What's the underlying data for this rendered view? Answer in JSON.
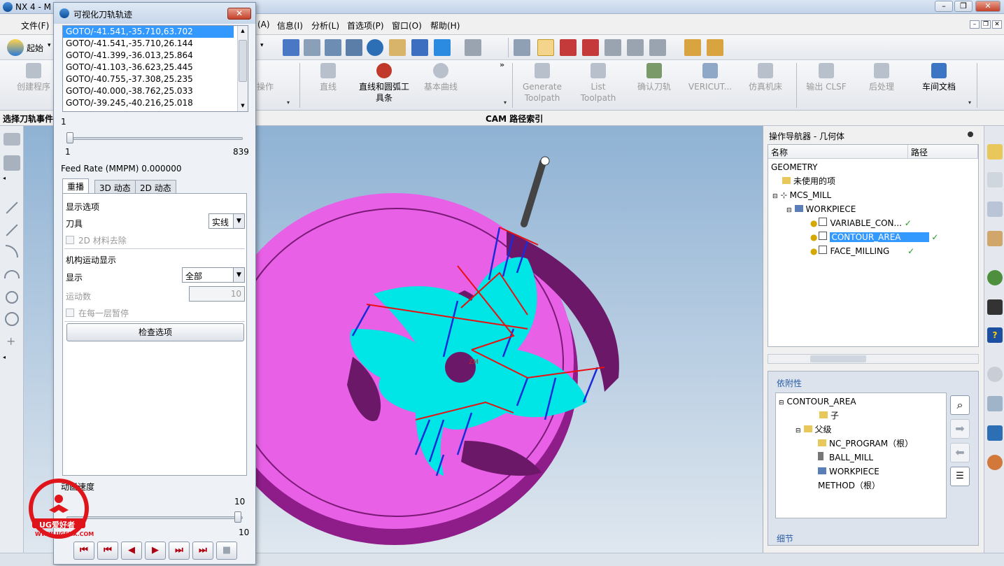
{
  "window": {
    "title": "NX 4 - M"
  },
  "menu": {
    "file": "文件(F)",
    "start": "起始",
    "a": "(A)",
    "info": "信息(I)",
    "analysis": "分析(L)",
    "prefs": "首选项(P)",
    "window": "窗口(O)",
    "help": "帮助(H)"
  },
  "toolbar2": {
    "create_program": "创建程序",
    "operation": "操作",
    "line": "直线",
    "line_arc_1": "直线和圆弧工",
    "line_arc_2": "具条",
    "basic_curve": "基本曲线",
    "generate_1": "Generate",
    "generate_2": "Toolpath",
    "list_1": "List",
    "list_2": "Toolpath",
    "verify": "确认刀轨",
    "vericut": "VERICUT...",
    "simulate": "仿真机床",
    "output_clsf": "输出 CLSF",
    "postprocess": "后处理",
    "shop_doc": "车间文档",
    "chevron": "»"
  },
  "cueline": {
    "left": "选择刀轨事件",
    "center": "CAM 路径索引"
  },
  "dialog": {
    "title": "可视化刀轨轨迹",
    "close": "✕",
    "goto_lines": [
      "GOTO/-41.541,-35.710,63.702",
      "GOTO/-41.541,-35.710,26.144",
      "GOTO/-41.399,-36.013,25.864",
      "GOTO/-41.103,-36.623,25.445",
      "GOTO/-40.755,-37.308,25.235",
      "GOTO/-40.000,-38.762,25.033",
      "GOTO/-39.245,-40.216,25.018"
    ],
    "slider_value": "1",
    "slider_min": "1",
    "slider_max": "839",
    "feed_rate": "Feed Rate (MMPM) 0.000000",
    "tabs": [
      "重播",
      "3D 动态",
      "2D 动态"
    ],
    "display_options": "显示选项",
    "tool": "刀具",
    "tool_value": "实线",
    "material_removal": "2D 材料去除",
    "mech_motion": "机构运动显示",
    "display": "显示",
    "display_value": "全部",
    "motion_count": "运动数",
    "motion_count_value": "10",
    "pause_each_layer": "在每一层暂停",
    "check_options": "检查选项",
    "anim_speed": "动画速度",
    "speed_top": "10",
    "speed_bottom": "10"
  },
  "navigator": {
    "title": "操作导航器 - 几何体",
    "col_name": "名称",
    "col_path": "路径",
    "rows": [
      "GEOMETRY",
      "未使用的项",
      "MCS_MILL",
      "WORKPIECE",
      "VARIABLE_CON...",
      "CONTOUR_AREA",
      "FACE_MILLING"
    ],
    "dependency": "依附性",
    "dep_rows": [
      "CONTOUR_AREA",
      "子",
      "父级",
      "NC_PROGRAM（根）",
      "BALL_MILL",
      "WORKPIECE",
      "METHOD（根）"
    ],
    "detail": "细节"
  },
  "graphics": {
    "label_zm": "ZM"
  },
  "logo": {
    "text": "UG爱好者",
    "url": "WWW.UGSNX.COM"
  }
}
